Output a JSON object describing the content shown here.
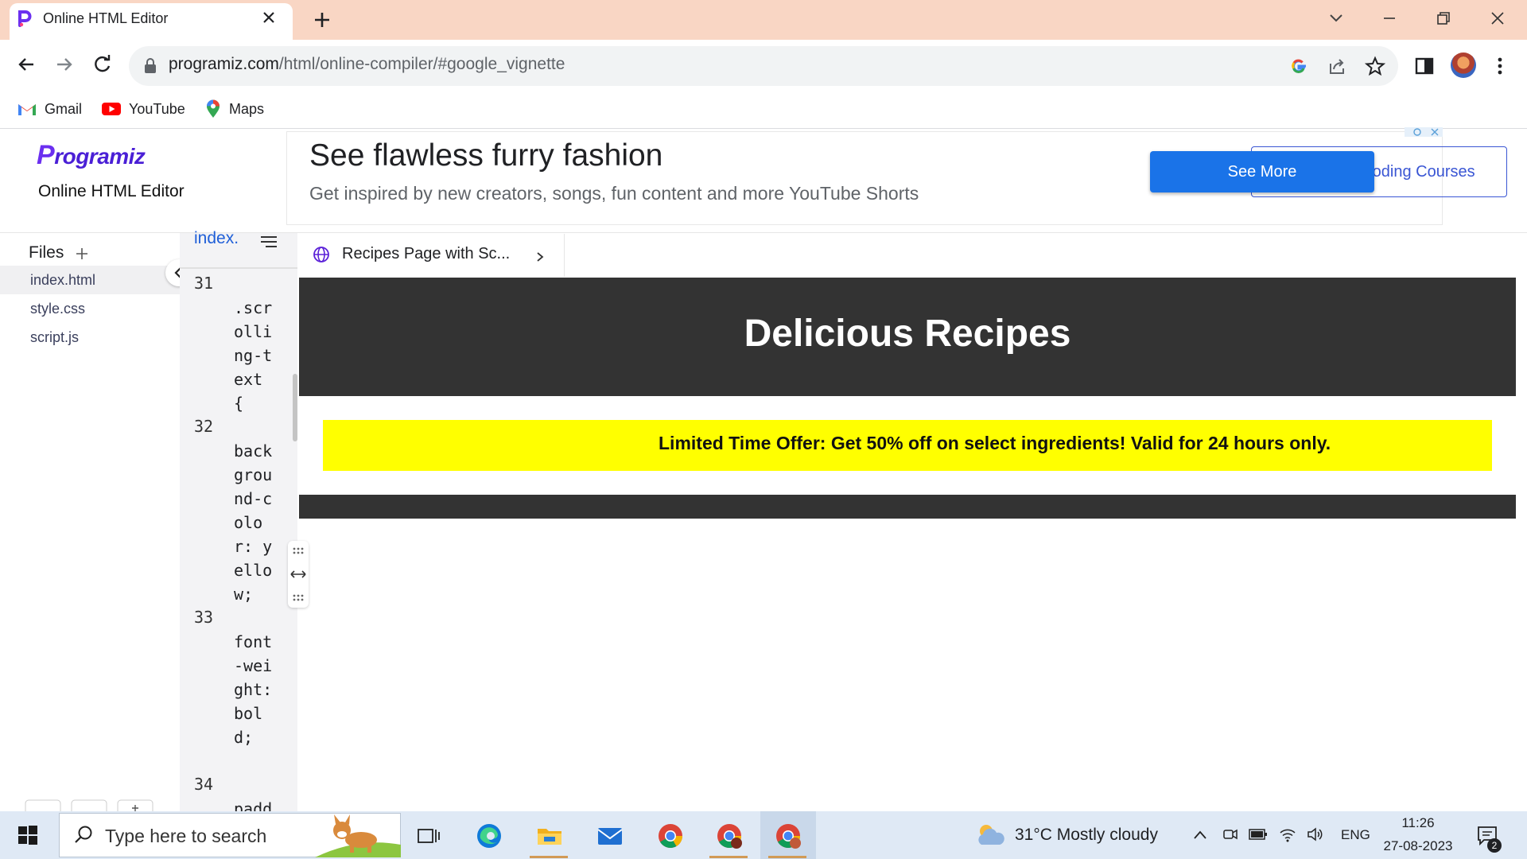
{
  "browser": {
    "tab_title": "Online HTML Editor",
    "url_host": "programiz.com",
    "url_path": "/html/online-compiler/#google_vignette",
    "bookmarks": [
      {
        "label": "Gmail",
        "icon": "gmail-icon"
      },
      {
        "label": "YouTube",
        "icon": "youtube-icon"
      },
      {
        "label": "Maps",
        "icon": "maps-icon"
      }
    ]
  },
  "site": {
    "logo_text": "rogramiz",
    "logo_initial": "P",
    "editor_title": "Online HTML Editor"
  },
  "ad": {
    "headline": "See flawless furry fashion",
    "subtext": "Get inspired by new creators, songs, fun content and more YouTube Shorts",
    "cta": "See More",
    "courses_button": "Interactive Coding Courses"
  },
  "files": {
    "title": "Files",
    "items": [
      "index.html",
      "style.css",
      "script.js"
    ]
  },
  "editor": {
    "tab_label": "index.html",
    "lines": [
      {
        "num": "31",
        "code": ".scrolling-text {"
      },
      {
        "num": "32",
        "code": "background-color: yellow;"
      },
      {
        "num": "33",
        "code": "font-weight: bold;"
      },
      {
        "num": "34",
        "code": "padd"
      }
    ]
  },
  "preview": {
    "tab_title": "Recipes Page with Sc...",
    "heading": "Delicious Recipes",
    "offer": "Limited Time Offer: Get 50% off on select ingredients! Valid for 24 hours only.",
    "colors": {
      "header_bg": "#333333",
      "banner_bg": "#ffff00"
    }
  },
  "taskbar": {
    "search_placeholder": "Type here to search",
    "weather": "31°C  Mostly cloudy",
    "language": "ENG",
    "time": "11:26",
    "date": "27-08-2023",
    "notification_count": "2",
    "apps": [
      "task-view-icon",
      "edge-icon",
      "file-explorer-icon",
      "mail-icon",
      "chrome-icon",
      "chrome-icon",
      "chrome-icon"
    ]
  }
}
